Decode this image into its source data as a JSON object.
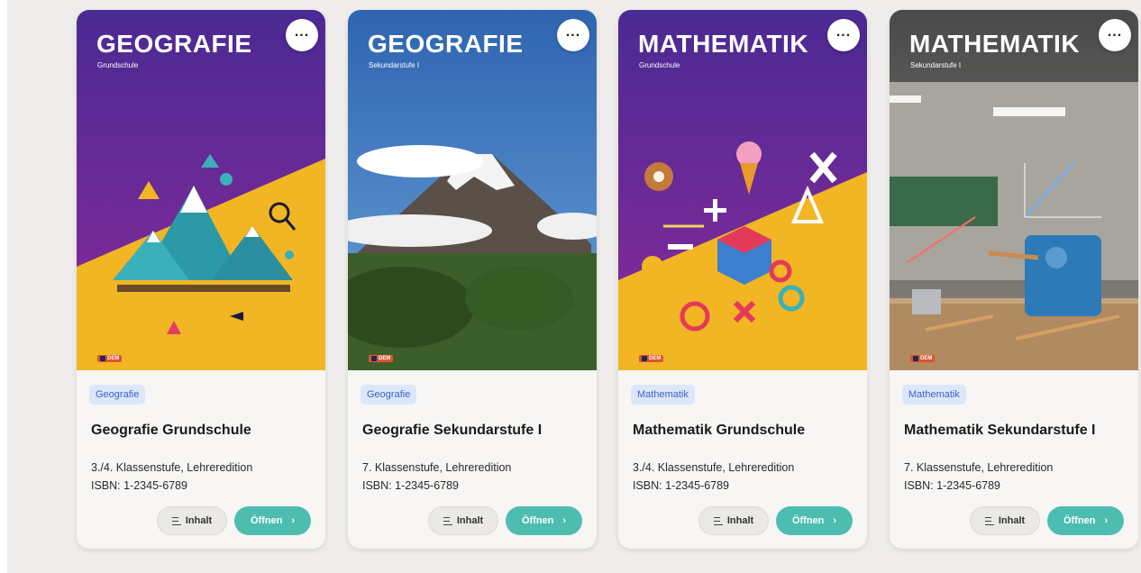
{
  "cards": [
    {
      "cover_title": "GEOGRAFIE",
      "cover_subtitle": "Grundschule",
      "publisher_logo": "DEM",
      "tag": "Geografie",
      "title": "Geografie Grundschule",
      "grade": "3./4. Klassenstufe, Lehreredition",
      "isbn": "ISBN: 1-2345-6789",
      "inhalt_label": "Inhalt",
      "open_label": "Öffnen",
      "cover_image": "illustrated-mountains"
    },
    {
      "cover_title": "GEOGRAFIE",
      "cover_subtitle": "Sekundarstufe I",
      "publisher_logo": "DEM",
      "tag": "Geografie",
      "title": "Geografie Sekundarstufe I",
      "grade": "7. Klassenstufe, Lehreredition",
      "isbn": "ISBN: 1-2345-6789",
      "inhalt_label": "Inhalt",
      "open_label": "Öffnen",
      "cover_image": "volcano-photo"
    },
    {
      "cover_title": "MATHEMATIK",
      "cover_subtitle": "Grundschule",
      "publisher_logo": "DEM",
      "tag": "Mathematik",
      "title": "Mathematik Grundschule",
      "grade": "3./4. Klassenstufe, Lehreredition",
      "isbn": "ISBN: 1-2345-6789",
      "inhalt_label": "Inhalt",
      "open_label": "Öffnen",
      "cover_image": "illustrated-math-shapes"
    },
    {
      "cover_title": "MATHEMATIK",
      "cover_subtitle": "Sekundarstufe I",
      "publisher_logo": "DEM",
      "tag": "Mathematik",
      "title": "Mathematik Sekundarstufe I",
      "grade": "7. Klassenstufe, Lehreredition",
      "isbn": "ISBN: 1-2345-6789",
      "inhalt_label": "Inhalt",
      "open_label": "Öffnen",
      "cover_image": "classroom-pencil-sharpener-photo"
    }
  ],
  "icons": {
    "more": "more-horizontal-icon",
    "inhalt": "list-icon",
    "open": "chevron-right-icon"
  },
  "colors": {
    "purple": "#5b2a9c",
    "yellow": "#f2b523",
    "teal_button": "#4dbdb2",
    "tag_bg": "#dce7fa",
    "tag_text": "#3b63c4"
  }
}
